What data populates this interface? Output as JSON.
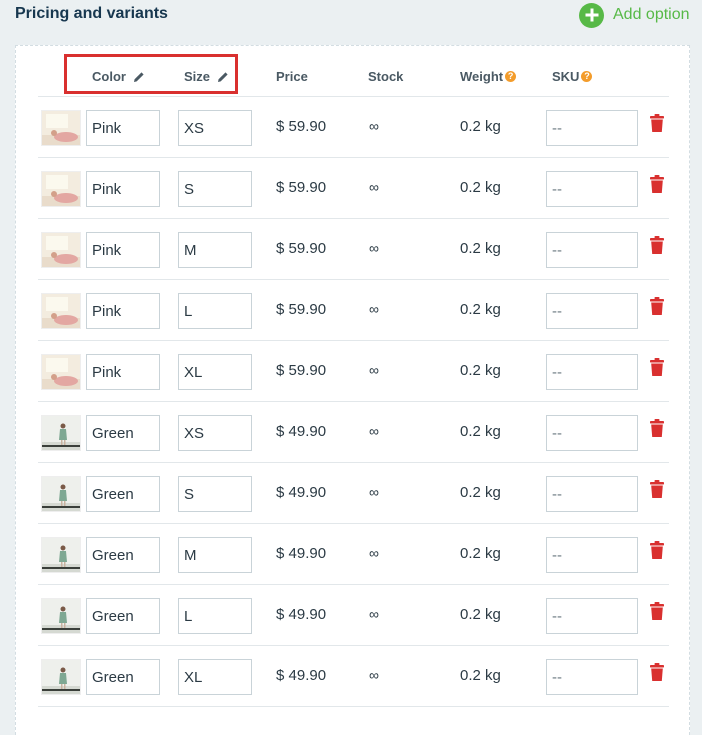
{
  "header": {
    "title": "Pricing and variants",
    "add_option_label": "Add option"
  },
  "table": {
    "columns": {
      "color": "Color",
      "size": "Size",
      "price": "Price",
      "stock": "Stock",
      "weight": "Weight",
      "sku": "SKU"
    },
    "help_glyph": "?",
    "rows": [
      {
        "color": "Pink",
        "size": "XS",
        "price": "$ 59.90",
        "stock": "∞",
        "weight": "0.2 kg",
        "sku": "--",
        "thumb": "pink"
      },
      {
        "color": "Pink",
        "size": "S",
        "price": "$ 59.90",
        "stock": "∞",
        "weight": "0.2 kg",
        "sku": "--",
        "thumb": "pink"
      },
      {
        "color": "Pink",
        "size": "M",
        "price": "$ 59.90",
        "stock": "∞",
        "weight": "0.2 kg",
        "sku": "--",
        "thumb": "pink"
      },
      {
        "color": "Pink",
        "size": "L",
        "price": "$ 59.90",
        "stock": "∞",
        "weight": "0.2 kg",
        "sku": "--",
        "thumb": "pink"
      },
      {
        "color": "Pink",
        "size": "XL",
        "price": "$ 59.90",
        "stock": "∞",
        "weight": "0.2 kg",
        "sku": "--",
        "thumb": "pink"
      },
      {
        "color": "Green",
        "size": "XS",
        "price": "$ 49.90",
        "stock": "∞",
        "weight": "0.2 kg",
        "sku": "--",
        "thumb": "green"
      },
      {
        "color": "Green",
        "size": "S",
        "price": "$ 49.90",
        "stock": "∞",
        "weight": "0.2 kg",
        "sku": "--",
        "thumb": "green"
      },
      {
        "color": "Green",
        "size": "M",
        "price": "$ 49.90",
        "stock": "∞",
        "weight": "0.2 kg",
        "sku": "--",
        "thumb": "green"
      },
      {
        "color": "Green",
        "size": "L",
        "price": "$ 49.90",
        "stock": "∞",
        "weight": "0.2 kg",
        "sku": "--",
        "thumb": "green"
      },
      {
        "color": "Green",
        "size": "XL",
        "price": "$ 49.90",
        "stock": "∞",
        "weight": "0.2 kg",
        "sku": "--",
        "thumb": "green"
      }
    ]
  },
  "colors": {
    "accent_green": "#57b947",
    "delete_red": "#d9302f",
    "help_orange": "#f39c2b",
    "highlight_red": "#d9302f"
  },
  "icons": {
    "add": "plus-circle-icon",
    "edit": "pencil-icon",
    "help": "question-circle-icon",
    "delete": "trash-icon"
  }
}
